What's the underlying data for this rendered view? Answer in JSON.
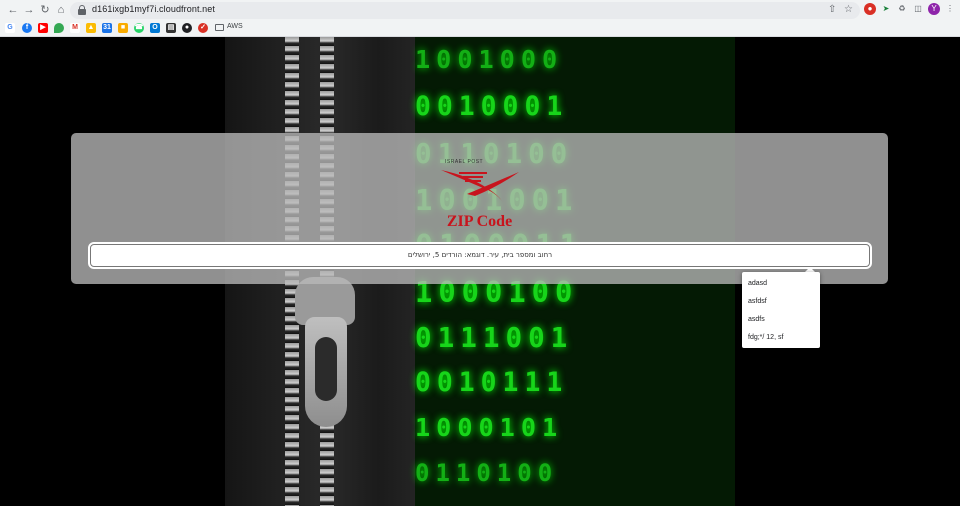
{
  "browser": {
    "url": "d161ixgb1myf7i.cloudfront.net",
    "profile_initial": "Y",
    "bookmarks": {
      "folder_label": "AWS"
    }
  },
  "page": {
    "logo_caption": "ISRAEL POST",
    "title": "ZIP Code",
    "address_placeholder": "רחוב ומספר בית, עיר. דוגמא: הורדים 5, ירושלים",
    "binary_rows": [
      "1001000",
      "0010001",
      "0110100",
      "1001001",
      "0100011",
      "1000100",
      "0111001",
      "0010111",
      "1000101",
      "0110100"
    ],
    "autocomplete": [
      "adasd",
      "asfdsf",
      "asdfs",
      "fdg;*/ 12, sf"
    ]
  }
}
